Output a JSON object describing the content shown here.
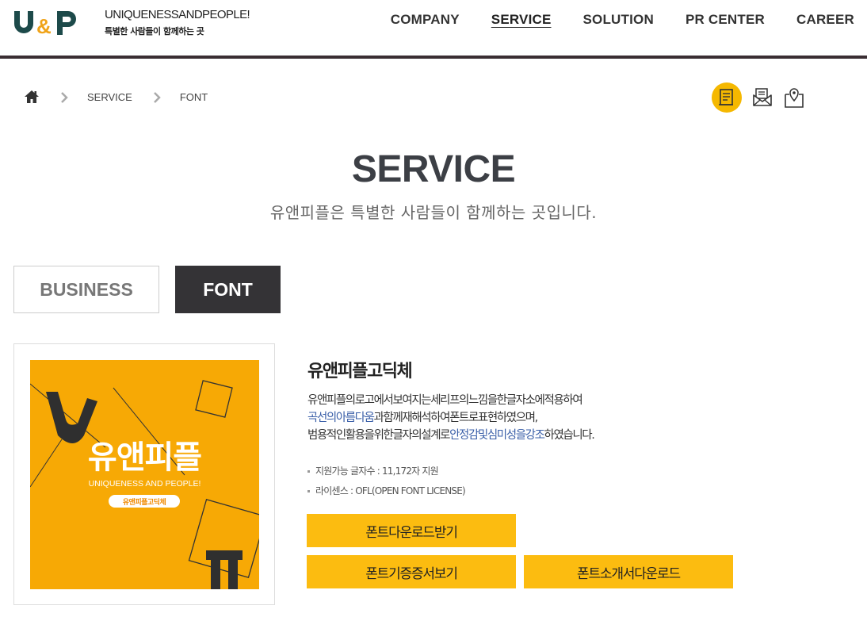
{
  "header": {
    "logo_text": "U&P",
    "tagline_en": "UNIQUENESSANDPEOPLE!",
    "tagline_ko": "특별한 사람들이 함께하는 곳",
    "nav": [
      {
        "label": "COMPANY",
        "active": false
      },
      {
        "label": "SERVICE",
        "active": true
      },
      {
        "label": "SOLUTION",
        "active": false
      },
      {
        "label": "PR CENTER",
        "active": false
      },
      {
        "label": "CAREER",
        "active": false
      }
    ]
  },
  "breadcrumb": {
    "home_icon": "home-icon",
    "items": [
      "SERVICE",
      "FONT"
    ]
  },
  "util_icons": [
    "document-icon",
    "mail-icon",
    "map-pin-icon"
  ],
  "page": {
    "title": "SERVICE",
    "subtitle": "유앤피플은 특별한 사람들이 함께하는 곳입니다."
  },
  "tabs": [
    {
      "label": "BUSINESS",
      "active": false
    },
    {
      "label": "FONT",
      "active": true
    }
  ],
  "product": {
    "title": "유앤피플고딕체",
    "desc_line1": "유앤피플의로고에서보여지는세리프의느낌을한글자소에적용하여",
    "desc_line2_hl": "곡선의아름다움",
    "desc_line2_rest": "과함께재해석하여폰트로표현하였으며,",
    "desc_line3_pre": "범용적인활용을위한글자의설계로",
    "desc_line3_hl": "안정감및심미성을강조",
    "desc_line3_post": "하였습니다.",
    "specs": [
      "지원가능 글자수 : 11,172자 지원",
      "라이센스 : OFL(OPEN FONT LICENSE)"
    ],
    "thumb": {
      "big_text": "유앤피플",
      "en_text": "UNIQUENESS AND PEOPLE!",
      "badge": "유앤피플고딕체",
      "bg_color": "#f7a905"
    },
    "buttons": {
      "download": "폰트다운로드받기",
      "certificate": "폰트기증증서보기",
      "intro": "폰트소개서다운로드"
    }
  },
  "colors": {
    "accent": "#fcbc10",
    "dark": "#343336",
    "logo_teal": "#1d4a4a",
    "logo_orange": "#f0a318"
  }
}
